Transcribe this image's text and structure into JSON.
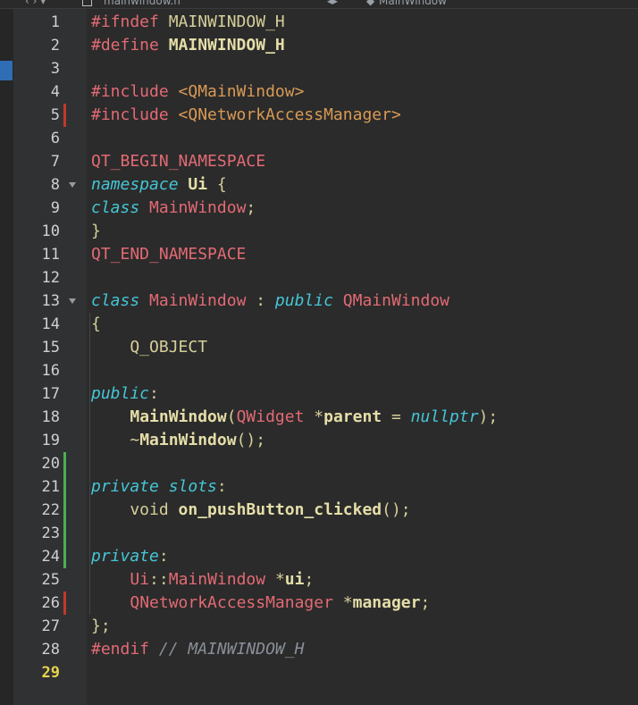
{
  "topbar": {
    "back_forward": "‹ › ▾",
    "file_icon": "file-icon",
    "file_name": "mainwindow.h",
    "symbol_nav": "◂▸",
    "class_icon": "class-icon",
    "class_name": "MainWindow"
  },
  "editor": {
    "current_line": 29,
    "lines": [
      {
        "n": "1",
        "t": [
          [
            "pp",
            "#ifndef"
          ],
          [
            "ident",
            " MAINWINDOW_H"
          ]
        ]
      },
      {
        "n": "2",
        "t": [
          [
            "pp",
            "#define"
          ],
          [
            "fn",
            " MAINWINDOW_H"
          ]
        ]
      },
      {
        "n": "3",
        "t": []
      },
      {
        "n": "4",
        "t": [
          [
            "pp",
            "#include"
          ],
          [
            "inc",
            " <QMainWindow>"
          ]
        ]
      },
      {
        "n": "5",
        "t": [
          [
            "pp",
            "#include"
          ],
          [
            "inc",
            " <QNetworkAccessManager>"
          ]
        ]
      },
      {
        "n": "6",
        "t": []
      },
      {
        "n": "7",
        "t": [
          [
            "pp",
            "QT_BEGIN_NAMESPACE"
          ]
        ]
      },
      {
        "n": "8",
        "t": [
          [
            "kw",
            "namespace"
          ],
          [
            "op",
            " "
          ],
          [
            "fn",
            "Ui"
          ],
          [
            "op",
            " {"
          ]
        ]
      },
      {
        "n": "9",
        "t": [
          [
            "kw",
            "class"
          ],
          [
            "op",
            " "
          ],
          [
            "type",
            "MainWindow"
          ],
          [
            "op",
            ";"
          ]
        ]
      },
      {
        "n": "10",
        "t": [
          [
            "op",
            "}"
          ]
        ]
      },
      {
        "n": "11",
        "t": [
          [
            "pp",
            "QT_END_NAMESPACE"
          ]
        ]
      },
      {
        "n": "12",
        "t": []
      },
      {
        "n": "13",
        "t": [
          [
            "kw",
            "class"
          ],
          [
            "op",
            " "
          ],
          [
            "type",
            "MainWindow"
          ],
          [
            "op",
            " : "
          ],
          [
            "kw",
            "public"
          ],
          [
            "op",
            " "
          ],
          [
            "type",
            "QMainWindow"
          ]
        ]
      },
      {
        "n": "14",
        "t": [
          [
            "op",
            "{"
          ]
        ]
      },
      {
        "n": "15",
        "t": [
          [
            "op",
            "    Q_OBJECT"
          ]
        ]
      },
      {
        "n": "16",
        "t": []
      },
      {
        "n": "17",
        "t": [
          [
            "kw",
            "public"
          ],
          [
            "op",
            ":"
          ]
        ]
      },
      {
        "n": "18",
        "t": [
          [
            "op",
            "    "
          ],
          [
            "fn",
            "MainWindow"
          ],
          [
            "op",
            "("
          ],
          [
            "type",
            "QWidget"
          ],
          [
            "op",
            " *"
          ],
          [
            "var",
            "parent"
          ],
          [
            "op",
            " = "
          ],
          [
            "kw",
            "nullptr"
          ],
          [
            "op",
            ");"
          ]
        ]
      },
      {
        "n": "19",
        "t": [
          [
            "op",
            "    ~"
          ],
          [
            "fn",
            "MainWindow"
          ],
          [
            "op",
            "();"
          ]
        ]
      },
      {
        "n": "20",
        "t": []
      },
      {
        "n": "21",
        "t": [
          [
            "kw",
            "private"
          ],
          [
            "op",
            " "
          ],
          [
            "kw",
            "slots"
          ],
          [
            "op",
            ":"
          ]
        ]
      },
      {
        "n": "22",
        "t": [
          [
            "op",
            "    void "
          ],
          [
            "fn",
            "on_pushButton_clicked"
          ],
          [
            "op",
            "();"
          ]
        ]
      },
      {
        "n": "23",
        "t": []
      },
      {
        "n": "24",
        "t": [
          [
            "kw",
            "private"
          ],
          [
            "op",
            ":"
          ]
        ]
      },
      {
        "n": "25",
        "t": [
          [
            "op",
            "    "
          ],
          [
            "type",
            "Ui"
          ],
          [
            "op",
            "::"
          ],
          [
            "type",
            "MainWindow"
          ],
          [
            "op",
            " *"
          ],
          [
            "var",
            "ui"
          ],
          [
            "op",
            ";"
          ]
        ]
      },
      {
        "n": "26",
        "t": [
          [
            "op",
            "    "
          ],
          [
            "type",
            "QNetworkAccessManager"
          ],
          [
            "op",
            " *"
          ],
          [
            "var",
            "manager"
          ],
          [
            "op",
            ";"
          ]
        ]
      },
      {
        "n": "27",
        "t": [
          [
            "op",
            "};"
          ]
        ]
      },
      {
        "n": "28",
        "t": [
          [
            "pp",
            "#endif"
          ],
          [
            "op",
            " "
          ],
          [
            "cm",
            "// MAINWINDOW_H"
          ]
        ]
      },
      {
        "n": "29",
        "t": []
      }
    ],
    "fold_lines": [
      8,
      13
    ],
    "change_marks": [
      {
        "line": 5,
        "kind": "red"
      },
      {
        "line": 20,
        "kind": "green"
      },
      {
        "line": 21,
        "kind": "green"
      },
      {
        "line": 22,
        "kind": "green"
      },
      {
        "line": 23,
        "kind": "green"
      },
      {
        "line": 24,
        "kind": "green"
      },
      {
        "line": 26,
        "kind": "red"
      }
    ],
    "colors": {
      "background": "#2b2b2b",
      "preprocessor": "#e36a74",
      "keyword": "#45c6d6",
      "include_path": "#d99a55",
      "current_line_number": "#e8d44d"
    }
  }
}
